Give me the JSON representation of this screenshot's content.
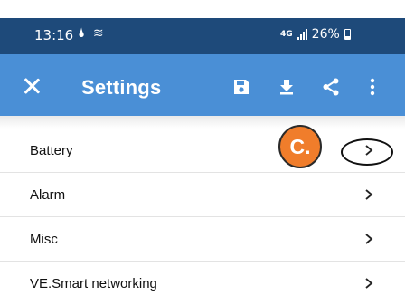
{
  "status_bar": {
    "time": "13:16",
    "network_badge": "4G",
    "battery_percent": "26%"
  },
  "app_bar": {
    "title": "Settings",
    "background": "#4a8fd6",
    "icons": [
      "close-icon",
      "save-icon",
      "download-icon",
      "share-icon",
      "more-vert-icon"
    ]
  },
  "annotation": {
    "label": "C.",
    "color": "#f07d2b"
  },
  "settings": {
    "items": [
      {
        "label": "Battery"
      },
      {
        "label": "Alarm"
      },
      {
        "label": "Misc"
      },
      {
        "label": "VE.Smart networking"
      }
    ]
  }
}
